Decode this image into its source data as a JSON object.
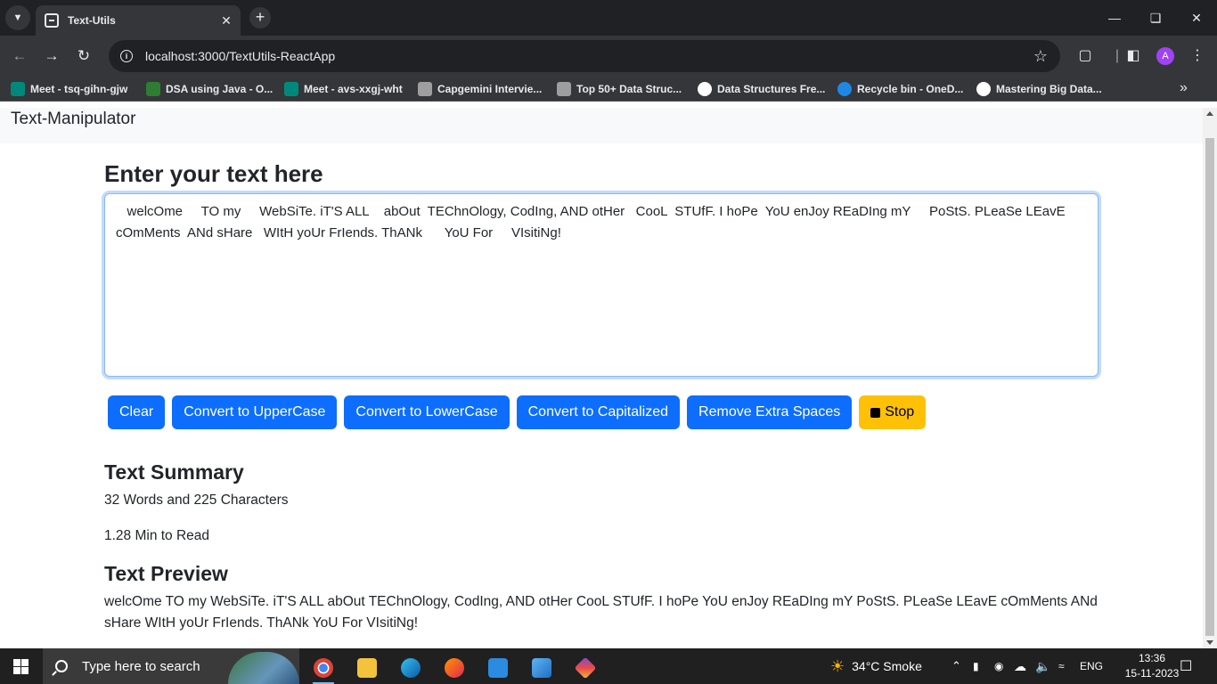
{
  "browser": {
    "tab_title": "Text-Utils",
    "url": "localhost:3000/TextUtils-ReactApp",
    "avatar_letter": "A",
    "bookmarks": [
      {
        "label": "Meet - tsq-gihn-gjw",
        "color": "#00897b"
      },
      {
        "label": "DSA using Java - O...",
        "color": "#2e7d32"
      },
      {
        "label": "Meet - avs-xxgj-wht",
        "color": "#00897b"
      },
      {
        "label": "Capgemini Intervie...",
        "color": "#9e9e9e"
      },
      {
        "label": "Top 50+ Data Struc...",
        "color": "#9e9e9e"
      },
      {
        "label": "Data Structures Fre...",
        "color": "#ffffff"
      },
      {
        "label": "Recycle bin - OneD...",
        "color": "#1e88e5"
      },
      {
        "label": "Mastering Big Data...",
        "color": "#ffffff"
      }
    ]
  },
  "app": {
    "brand": "Text-Manipulator",
    "heading": "Enter your text here",
    "textarea_value": "   welcOme     TO my     WebSiTe. iT'S ALL    abOut  TEChnOlogy, CodIng, AND otHer   CooL  STUfF. I hoPe  YoU enJoy REaDIng mY     PoStS. PLeaSe LEavE   cOmMents  ANd sHare   WItH yoUr FrIends. ThANk      YoU For     VIsitiNg!",
    "buttons": {
      "clear": "Clear",
      "upper": "Convert to UpperCase",
      "lower": "Convert to LowerCase",
      "capitalized": "Convert to Capitalized",
      "extra_spaces": "Remove Extra Spaces",
      "stop": "Stop"
    },
    "summary_title": "Text Summary",
    "summary_counts": "32 Words and 225 Characters",
    "read_time": "1.28 Min to Read",
    "preview_title": "Text Preview",
    "preview_text": "welcOme TO my WebSiTe. iT'S ALL abOut TEChnOlogy, CodIng, AND otHer CooL STUfF. I hoPe YoU enJoy REaDIng mY PoStS. PLeaSe LEavE cOmMents ANd sHare WItH yoUr FrIends. ThANk YoU For VIsitiNg!"
  },
  "taskbar": {
    "search_placeholder": "Type here to search",
    "weather": "34°C  Smoke",
    "language": "ENG",
    "time": "13:36",
    "date": "15-11-2023",
    "colors": {
      "accent": "#0d6efd",
      "warning": "#ffc107"
    }
  }
}
